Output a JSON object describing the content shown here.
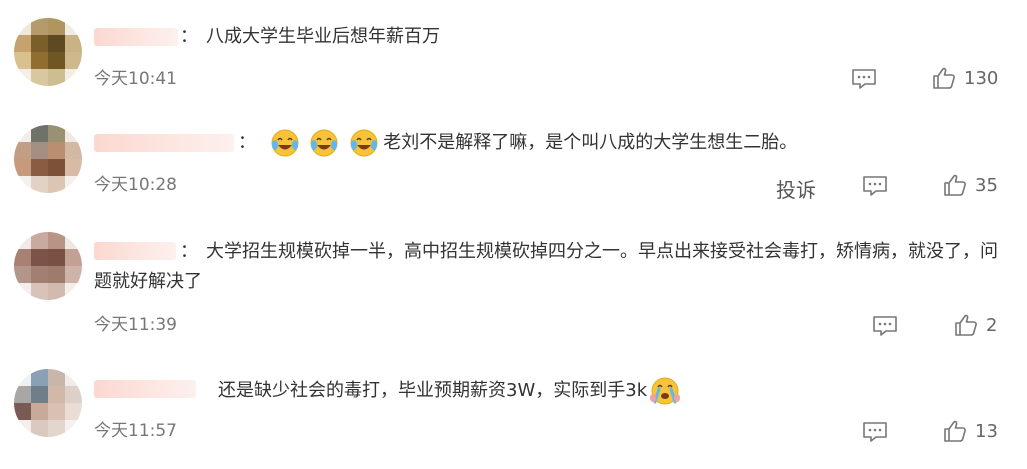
{
  "comments": [
    {
      "text": "八成大学生毕业后想年薪百万",
      "colon": "：",
      "time": "今天10:41",
      "likes": "130"
    },
    {
      "text": "老刘不是解释了嘛，是个叫八成的大学生想生二胎。",
      "colon": "：",
      "emojis": [
        "laugh-cry-emoji",
        "laugh-cry-emoji",
        "laugh-cry-emoji"
      ],
      "time": "今天10:28",
      "report_label": "投诉",
      "likes": "35"
    },
    {
      "text": "大学招生规模砍掉一半，高中招生规模砍掉四分之一。早点出来接受社会毒打，矫情病，就没了，问题就好解决了",
      "colon": "：",
      "time": "今天11:39",
      "likes": "2"
    },
    {
      "text": "还是缺少社会的毒打，毕业预期薪资3W，实际到手3k",
      "emojis": [
        "crying-emoji"
      ],
      "time": "今天11:57",
      "likes": "13"
    }
  ],
  "colors": {
    "text": "#333333",
    "time": "#777777",
    "icon": "#777777",
    "username_blur": "#fbd8d0"
  }
}
